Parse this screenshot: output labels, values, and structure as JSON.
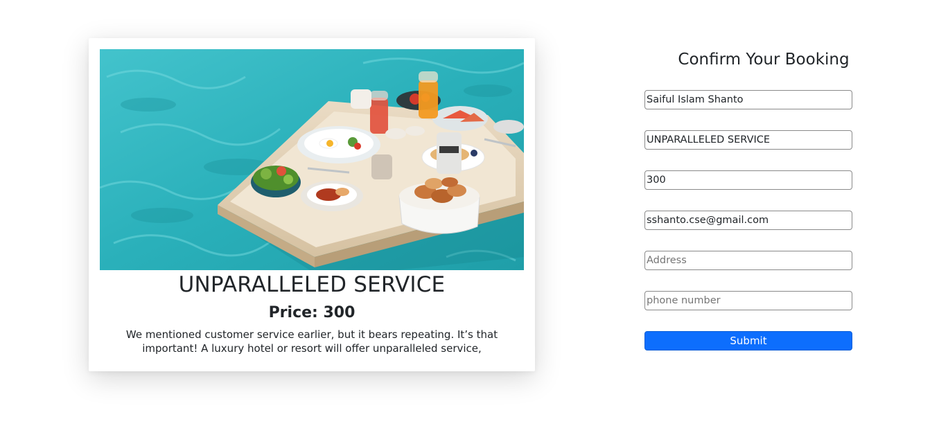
{
  "service": {
    "image_alt": "Floating breakfast tray in a swimming pool",
    "title": "UNPARALLELED SERVICE",
    "price": "Price: 300",
    "description": "We mentioned customer service earlier, but it bears repeating. It’s that important! A luxury hotel or resort will offer unparalleled service,"
  },
  "booking_form": {
    "title": "Confirm Your Booking",
    "fields": {
      "name": {
        "value": "Saiful Islam Shanto",
        "placeholder": ""
      },
      "service": {
        "value": "UNPARALLELED SERVICE",
        "placeholder": ""
      },
      "price": {
        "value": "300",
        "placeholder": ""
      },
      "email": {
        "value": "sshanto.cse@gmail.com",
        "placeholder": ""
      },
      "address": {
        "value": "",
        "placeholder": "Address"
      },
      "phone": {
        "value": "",
        "placeholder": "phone number"
      }
    },
    "submit_label": "Submit"
  },
  "colors": {
    "primary": "#0d6efd",
    "text": "#212529",
    "pool": "#2fb4bd"
  }
}
